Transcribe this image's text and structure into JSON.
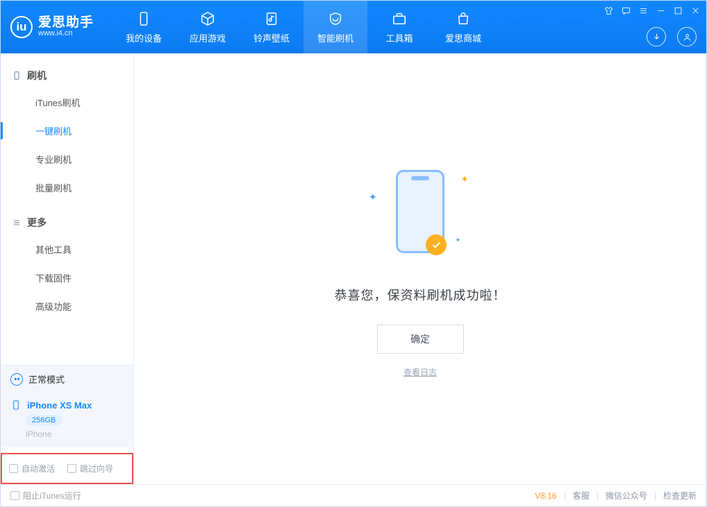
{
  "brand": {
    "name": "爱思助手",
    "site": "www.i4.cn"
  },
  "header_tabs": [
    {
      "label": "我的设备"
    },
    {
      "label": "应用游戏"
    },
    {
      "label": "铃声壁纸"
    },
    {
      "label": "智能刷机"
    },
    {
      "label": "工具箱"
    },
    {
      "label": "爱思商城"
    }
  ],
  "sidebar": {
    "group_flash": "刷机",
    "group_more": "更多",
    "items_flash": [
      {
        "label": "iTunes刷机"
      },
      {
        "label": "一键刷机"
      },
      {
        "label": "专业刷机"
      },
      {
        "label": "批量刷机"
      }
    ],
    "items_more": [
      {
        "label": "其他工具"
      },
      {
        "label": "下载固件"
      },
      {
        "label": "高级功能"
      }
    ]
  },
  "mode_label": "正常模式",
  "device": {
    "name": "iPhone XS Max",
    "capacity": "256GB",
    "type": "iPhone"
  },
  "checks": {
    "auto_activate": "自动激活",
    "skip_guide": "跳过向导"
  },
  "main": {
    "success_message": "恭喜您，保资料刷机成功啦！",
    "ok_label": "确定",
    "log_link": "查看日志"
  },
  "status": {
    "block_itunes": "阻止iTunes运行",
    "version": "V8.16",
    "links": [
      "客服",
      "微信公众号",
      "检查更新"
    ]
  }
}
